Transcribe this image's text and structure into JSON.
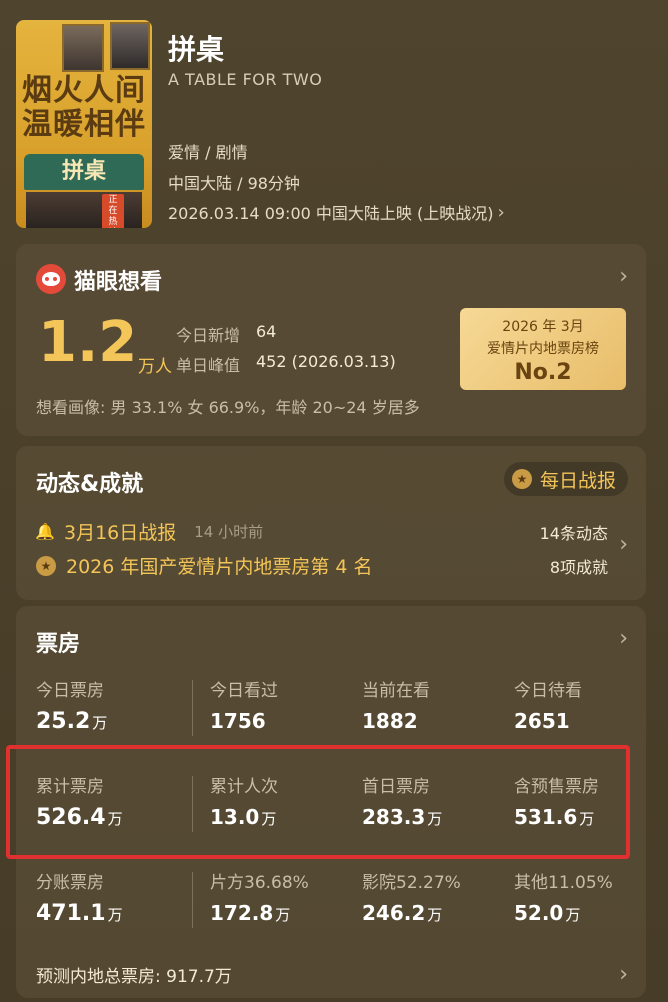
{
  "movie": {
    "title": "拼桌",
    "english_title": "A TABLE FOR TWO",
    "genre": "爱情 / 剧情",
    "meta": "中国大陆 / 98分钟",
    "release": "2026.03.14 09:00 中国大陆上映 (上映战况)",
    "poster": {
      "line1": "烟火人间",
      "line2": "温暖相伴",
      "sign": "拼桌",
      "badge": "正在热映"
    }
  },
  "maoyan": {
    "title": "猫眼想看",
    "count": "1.2",
    "count_unit": "万人",
    "today_new_label": "今日新增",
    "today_new_value": "64",
    "peak_label": "单日峰值",
    "peak_value": "452 (2026.03.13)",
    "rank": {
      "line1": "2026 年 3月",
      "line2": "爱情片内地票房榜",
      "line3": "No.2"
    },
    "portrait": "想看画像: 男 33.1%  女 66.9%，年龄 20~24 岁居多"
  },
  "dynamics": {
    "title": "动态&成就",
    "daily_report": "每日战报",
    "report_title": "3月16日战报",
    "report_time": "14 小时前",
    "achievement": "2026 年国产爱情片内地票房第 4 名",
    "dynamic_count": "14条动态",
    "achievement_count": "8项成就"
  },
  "box_office": {
    "title": "票房",
    "rows": [
      [
        {
          "label": "今日票房",
          "value": "25.2",
          "unit": "万"
        },
        {
          "label": "今日看过",
          "value": "1756",
          "unit": ""
        },
        {
          "label": "当前在看",
          "value": "1882",
          "unit": ""
        },
        {
          "label": "今日待看",
          "value": "2651",
          "unit": ""
        }
      ],
      [
        {
          "label": "累计票房",
          "value": "526.4",
          "unit": "万"
        },
        {
          "label": "累计人次",
          "value": "13.0",
          "unit": "万"
        },
        {
          "label": "首日票房",
          "value": "283.3",
          "unit": "万"
        },
        {
          "label": "含预售票房",
          "value": "531.6",
          "unit": "万"
        }
      ],
      [
        {
          "label": "分账票房",
          "value": "471.1",
          "unit": "万"
        },
        {
          "label": "片方36.68%",
          "value": "172.8",
          "unit": "万"
        },
        {
          "label": "影院52.27%",
          "value": "246.2",
          "unit": "万"
        },
        {
          "label": "其他11.05%",
          "value": "52.0",
          "unit": "万"
        }
      ]
    ],
    "forecast": "预测内地总票房: 917.7万"
  },
  "colors": {
    "accent": "#f4c558",
    "highlight_border": "#e0302f",
    "background": "#4a3f2a"
  }
}
